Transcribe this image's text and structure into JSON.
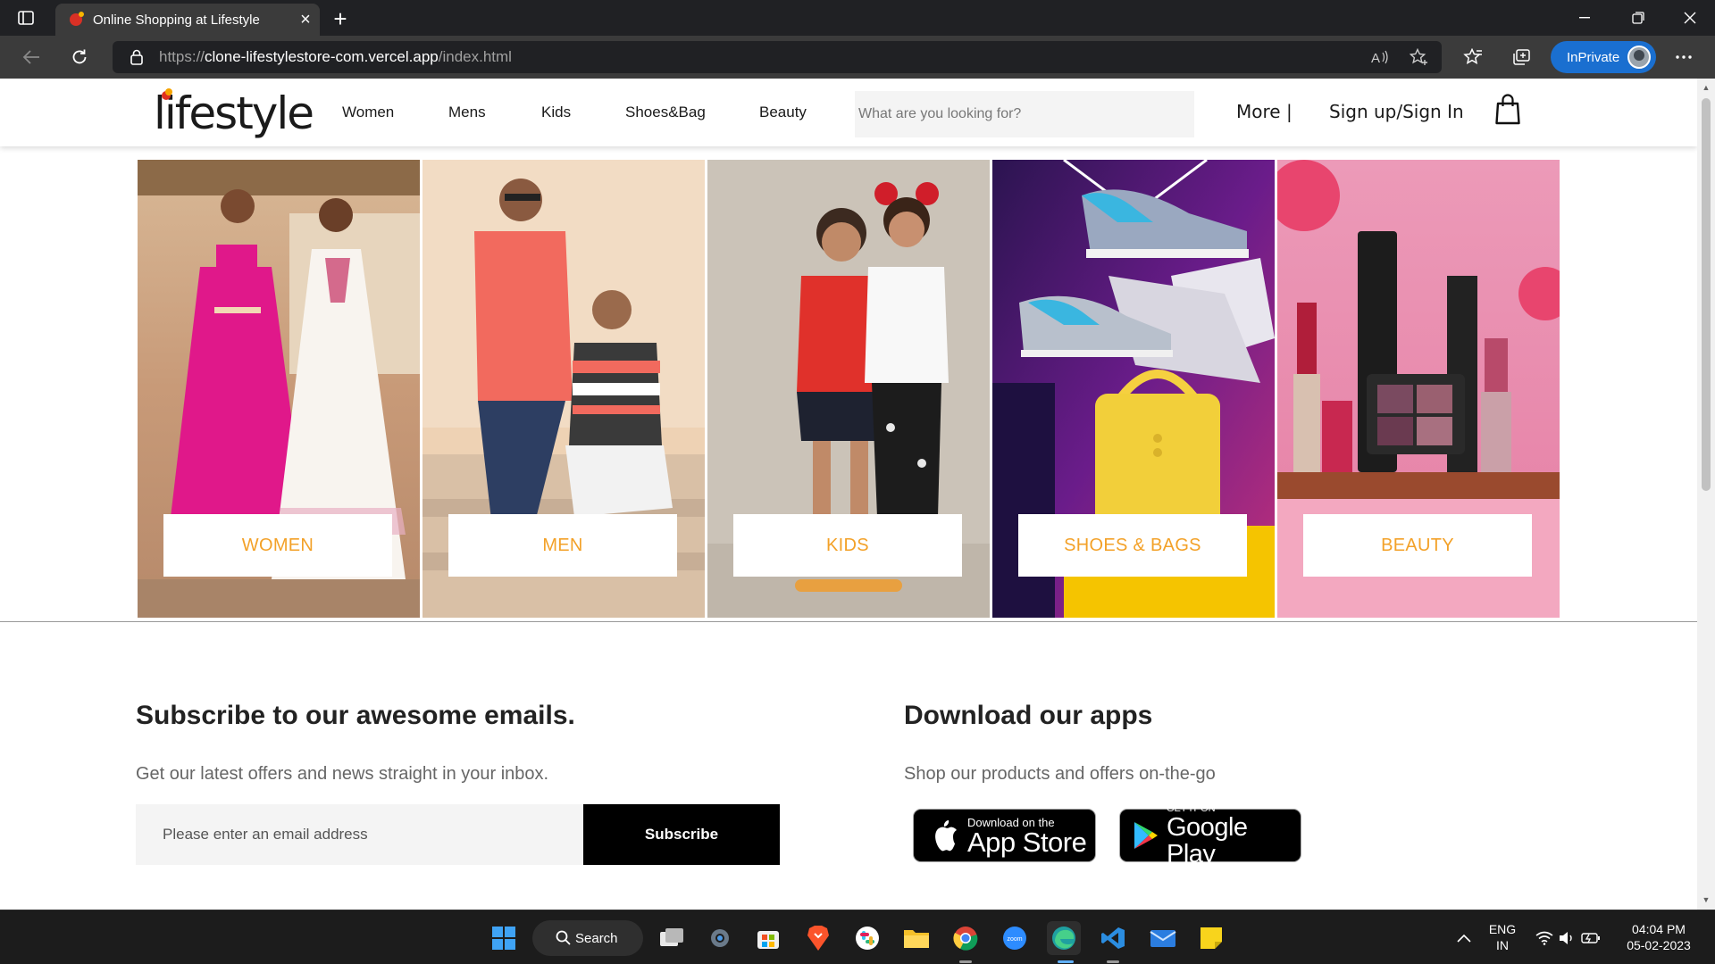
{
  "browser": {
    "tab_title": "Online Shopping at Lifestyle",
    "url_scheme": "https://",
    "url_host": "clone-lifestylestore-com.vercel.app",
    "url_path": "/index.html",
    "inprivate_label": "InPrivate"
  },
  "header": {
    "logo": "lifestyle",
    "nav": [
      "Women",
      "Mens",
      "Kids",
      "Shoes&Bag",
      "Beauty"
    ],
    "search_placeholder": "What are you looking for?",
    "more_label": "More |",
    "signin_label": "Sign up/Sign In",
    "bag_icon": "shopping-bag-icon"
  },
  "categories": [
    {
      "label": "WOMEN",
      "bg": "#c89a78"
    },
    {
      "label": "MEN",
      "bg": "#e8c8a8"
    },
    {
      "label": "KIDS",
      "bg": "#c9c1b6"
    },
    {
      "label": "SHOES & BAGS",
      "bg": "#4a1b6a"
    },
    {
      "label": "BEAUTY",
      "bg": "#e98fb0"
    }
  ],
  "subscribe": {
    "title": "Subscribe to our awesome emails.",
    "subtitle": "Get our latest offers and news straight in your inbox.",
    "email_placeholder": "Please enter an email address",
    "button_label": "Subscribe"
  },
  "apps": {
    "title": "Download our apps",
    "subtitle": "Shop our products and offers on-the-go",
    "appstore_small": "Download on the",
    "appstore_big": "App Store",
    "googleplay_small": "GET IT ON",
    "googleplay_big": "Google Play"
  },
  "taskbar": {
    "search_label": "Search",
    "lang_line1": "ENG",
    "lang_line2": "IN",
    "time": "04:04 PM",
    "date": "05-02-2023"
  },
  "colors": {
    "accent_label": "#f3a128",
    "inprivate_blue": "#1a6fd0"
  }
}
